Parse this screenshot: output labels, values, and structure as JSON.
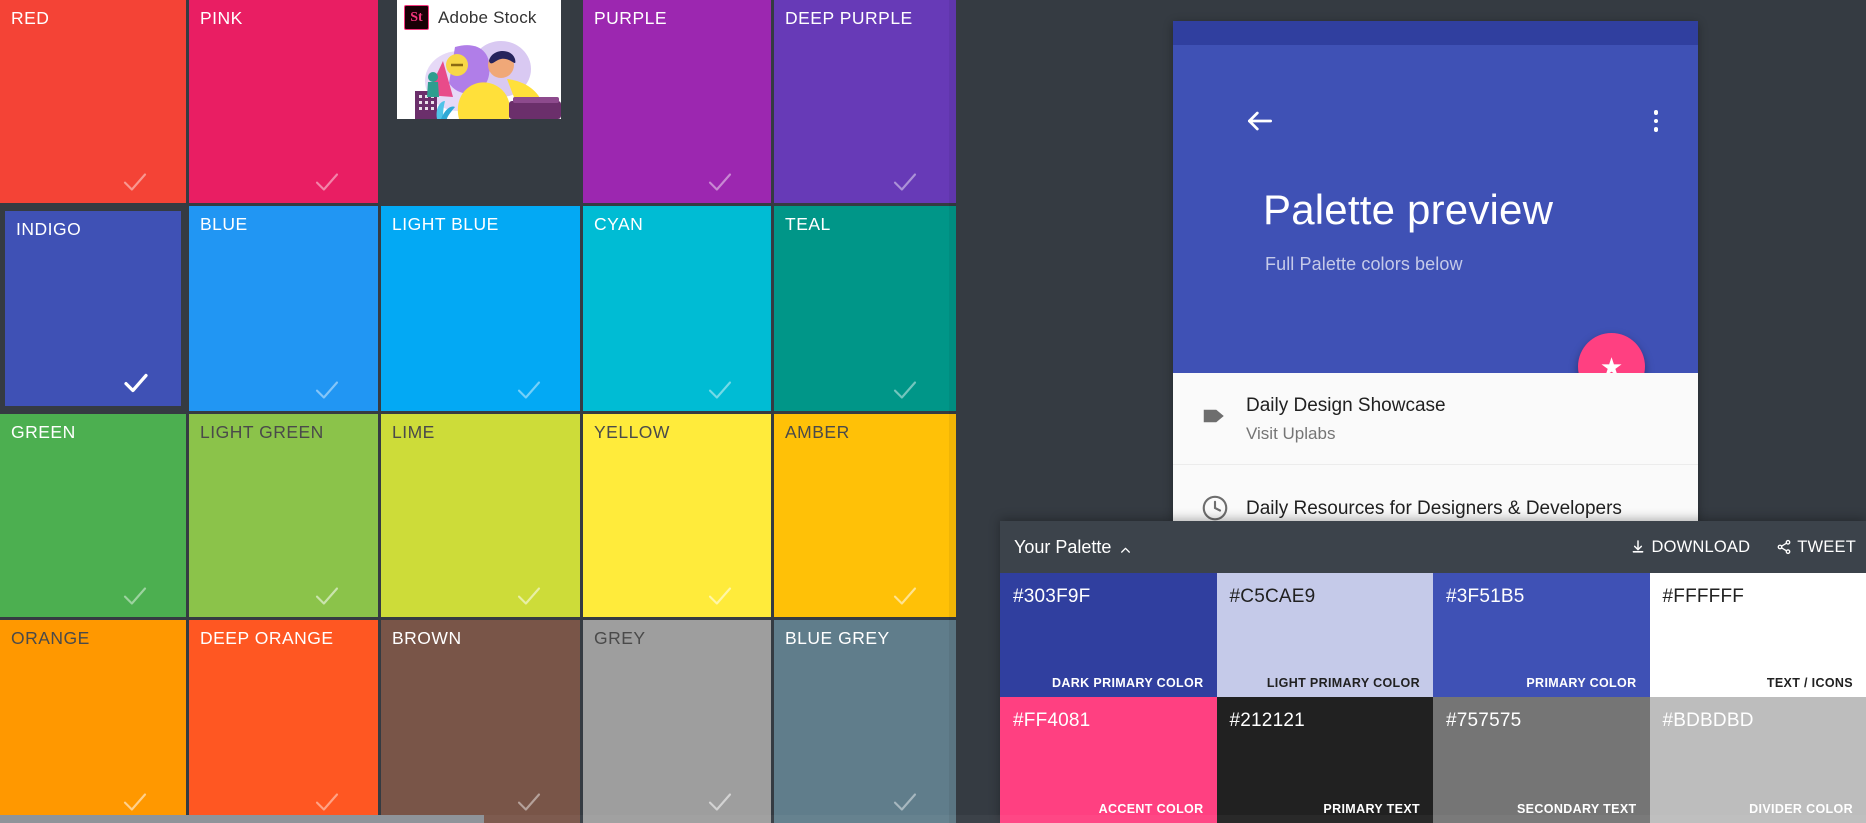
{
  "app": {
    "background_color": "#353b42"
  },
  "color_grid": {
    "rows": 4,
    "cols": 5,
    "tiles": [
      {
        "label": "RED",
        "color": "#f44336",
        "label_color": "#ffffff",
        "check": true,
        "selected": false
      },
      {
        "label": "PINK",
        "color": "#e91e63",
        "label_color": "#ffffff",
        "check": true,
        "selected": false
      },
      {
        "label": "AD_SLOT",
        "color": "#353b42",
        "label_color": "#ffffff",
        "check": false,
        "selected": false
      },
      {
        "label": "PURPLE",
        "color": "#9c27b0",
        "label_color": "#ffffff",
        "check": true,
        "selected": false
      },
      {
        "label": "DEEP PURPLE",
        "color": "#673ab7",
        "label_color": "#ffffff",
        "check": true,
        "selected": false
      },
      {
        "label": "INDIGO",
        "color": "#3f51b5",
        "label_color": "#ffffff",
        "check": true,
        "selected": true
      },
      {
        "label": "BLUE",
        "color": "#2196f3",
        "label_color": "#ffffff",
        "check": true,
        "selected": false
      },
      {
        "label": "LIGHT BLUE",
        "color": "#03a9f4",
        "label_color": "#ffffff",
        "check": true,
        "selected": false
      },
      {
        "label": "CYAN",
        "color": "#00bcd4",
        "label_color": "#ffffff",
        "check": true,
        "selected": false
      },
      {
        "label": "TEAL",
        "color": "#009688",
        "label_color": "#ffffff",
        "check": true,
        "selected": false
      },
      {
        "label": "GREEN",
        "color": "#4caf50",
        "label_color": "#ffffff",
        "check": true,
        "selected": false
      },
      {
        "label": "LIGHT GREEN",
        "color": "#8bc34a",
        "label_color": "#4a4a4a",
        "check": true,
        "selected": false
      },
      {
        "label": "LIME",
        "color": "#cddc39",
        "label_color": "#4a4a4a",
        "check": true,
        "selected": false
      },
      {
        "label": "YELLOW",
        "color": "#ffeb3b",
        "label_color": "#4a4a4a",
        "check": true,
        "selected": false
      },
      {
        "label": "AMBER",
        "color": "#ffc107",
        "label_color": "#4a4a4a",
        "check": true,
        "selected": false
      },
      {
        "label": "ORANGE",
        "color": "#ff9800",
        "label_color": "#4a4a4a",
        "check": true,
        "selected": false
      },
      {
        "label": "DEEP ORANGE",
        "color": "#ff5722",
        "label_color": "#ffffff",
        "check": true,
        "selected": false
      },
      {
        "label": "BROWN",
        "color": "#795548",
        "label_color": "#ffffff",
        "check": true,
        "selected": false
      },
      {
        "label": "GREY",
        "color": "#9e9e9e",
        "label_color": "#4a4a4a",
        "check": true,
        "selected": false
      },
      {
        "label": "BLUE GREY",
        "color": "#607d8b",
        "label_color": "#ffffff",
        "check": true,
        "selected": false
      }
    ]
  },
  "ad": {
    "logo_text": "St",
    "brand": "Adobe Stock"
  },
  "preview": {
    "statusbar_color": "#303f9f",
    "appbar_color": "#3f51b5",
    "title": "Palette preview",
    "subtitle": "Full Palette colors below",
    "fab": {
      "icon": "star-icon",
      "glyph": "★",
      "color": "#ff4081"
    },
    "list": [
      {
        "icon": "label-icon",
        "title": "Daily Design Showcase",
        "subtitle": "Visit Uplabs"
      },
      {
        "icon": "clock-icon",
        "title": "Daily Resources for Designers & Developers",
        "subtitle": ""
      }
    ]
  },
  "palette_panel": {
    "title": "Your Palette",
    "collapse_icon": "chevron-up-icon",
    "actions": [
      {
        "icon": "download-icon",
        "label": "DOWNLOAD"
      },
      {
        "icon": "tweet-icon",
        "label": "TWEET"
      }
    ],
    "swatches": [
      {
        "hex": "#303F9F",
        "role": "DARK PRIMARY COLOR",
        "bg": "#303f9f",
        "fg": "#ffffff"
      },
      {
        "hex": "#C5CAE9",
        "role": "LIGHT PRIMARY COLOR",
        "bg": "#c5cae9",
        "fg": "#212121"
      },
      {
        "hex": "#3F51B5",
        "role": "PRIMARY COLOR",
        "bg": "#3f51b5",
        "fg": "#ffffff"
      },
      {
        "hex": "#FFFFFF",
        "role": "TEXT / ICONS",
        "bg": "#ffffff",
        "fg": "#212121"
      },
      {
        "hex": "#FF4081",
        "role": "ACCENT COLOR",
        "bg": "#ff4081",
        "fg": "#ffffff"
      },
      {
        "hex": "#212121",
        "role": "PRIMARY TEXT",
        "bg": "#212121",
        "fg": "#ffffff"
      },
      {
        "hex": "#757575",
        "role": "SECONDARY TEXT",
        "bg": "#757575",
        "fg": "#ffffff"
      },
      {
        "hex": "#BDBDBD",
        "role": "DIVIDER COLOR",
        "bg": "#bdbdbd",
        "fg": "#ffffff"
      }
    ]
  }
}
